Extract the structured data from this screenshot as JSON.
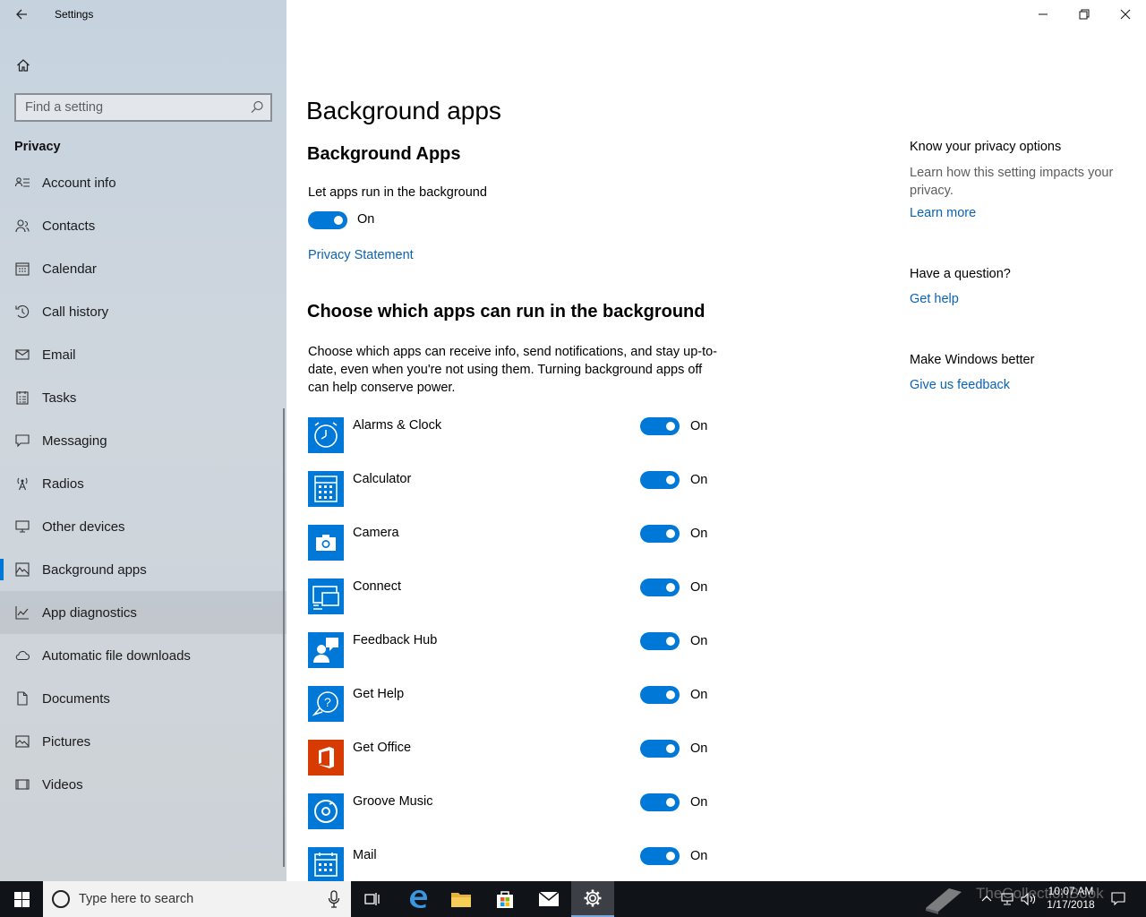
{
  "window": {
    "title": "Settings",
    "controls": [
      "minimize",
      "restore",
      "close"
    ]
  },
  "sidebar": {
    "search_placeholder": "Find a setting",
    "section": "Privacy",
    "items": [
      {
        "label": "Account info",
        "icon": "account-info-icon"
      },
      {
        "label": "Contacts",
        "icon": "contacts-icon"
      },
      {
        "label": "Calendar",
        "icon": "calendar-icon"
      },
      {
        "label": "Call history",
        "icon": "call-history-icon"
      },
      {
        "label": "Email",
        "icon": "email-icon"
      },
      {
        "label": "Tasks",
        "icon": "tasks-icon"
      },
      {
        "label": "Messaging",
        "icon": "messaging-icon"
      },
      {
        "label": "Radios",
        "icon": "radios-icon"
      },
      {
        "label": "Other devices",
        "icon": "other-devices-icon"
      },
      {
        "label": "Background apps",
        "icon": "background-apps-icon",
        "selected": true
      },
      {
        "label": "App diagnostics",
        "icon": "app-diagnostics-icon",
        "hover": true
      },
      {
        "label": "Automatic file downloads",
        "icon": "cloud-icon"
      },
      {
        "label": "Documents",
        "icon": "documents-icon"
      },
      {
        "label": "Pictures",
        "icon": "pictures-icon"
      },
      {
        "label": "Videos",
        "icon": "videos-icon"
      }
    ]
  },
  "main": {
    "page_title": "Background apps",
    "sub_title": "Background Apps",
    "master_label": "Let apps run in the background",
    "master_state": "On",
    "privacy_link": "Privacy Statement",
    "choose_title": "Choose which apps can run in the background",
    "choose_desc": "Choose which apps can receive info, send notifications, and stay up-to-date, even when you're not using them. Turning background apps off can help conserve power.",
    "apps": [
      {
        "name": "Alarms & Clock",
        "state": "On",
        "icon": "alarms-clock-icon",
        "color": "#0078d7"
      },
      {
        "name": "Calculator",
        "state": "On",
        "icon": "calculator-icon",
        "color": "#0078d7"
      },
      {
        "name": "Camera",
        "state": "On",
        "icon": "camera-icon",
        "color": "#0078d7"
      },
      {
        "name": "Connect",
        "state": "On",
        "icon": "connect-icon",
        "color": "#0078d7"
      },
      {
        "name": "Feedback Hub",
        "state": "On",
        "icon": "feedback-hub-icon",
        "color": "#0078d7"
      },
      {
        "name": "Get Help",
        "state": "On",
        "icon": "get-help-icon",
        "color": "#0078d7"
      },
      {
        "name": "Get Office",
        "state": "On",
        "icon": "office-icon",
        "color": "#d83b01"
      },
      {
        "name": "Groove Music",
        "state": "On",
        "icon": "groove-music-icon",
        "color": "#0078d7"
      },
      {
        "name": "Mail",
        "state": "On",
        "icon": "mail-icon",
        "color": "#0078d7"
      }
    ]
  },
  "aside": {
    "privacy_heading": "Know your privacy options",
    "privacy_text": "Learn how this setting impacts your privacy.",
    "learn_more": "Learn more",
    "question_heading": "Have a question?",
    "get_help": "Get help",
    "better_heading": "Make Windows better",
    "feedback": "Give us feedback"
  },
  "taskbar": {
    "search_placeholder": "Type here to search",
    "time": "10:07 AM",
    "date": "1/17/2018",
    "watermark": "TheCollectionBook"
  },
  "colors": {
    "accent": "#0078d7",
    "link": "#0a63b5",
    "office": "#d83b01"
  }
}
